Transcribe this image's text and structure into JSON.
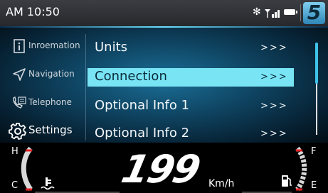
{
  "status": {
    "time": "AM 10:50",
    "bluetooth_glyph": "✻"
  },
  "sidebar": {
    "items": [
      {
        "label": "Inroemation",
        "icon": "info-icon"
      },
      {
        "label": "Navigation",
        "icon": "navigation-arrow-icon"
      },
      {
        "label": "Telephone",
        "icon": "telephone-icon"
      },
      {
        "label": "Settings",
        "icon": "gear-icon",
        "active": true
      }
    ]
  },
  "menu": {
    "items": [
      {
        "label": "Units",
        "arrow": ">>>"
      },
      {
        "label": "Connection",
        "arrow": ">>>",
        "selected": true
      },
      {
        "label": "Optional Info 1",
        "arrow": ">>>"
      },
      {
        "label": "Optional Info 2",
        "arrow": ">>>"
      }
    ]
  },
  "cluster": {
    "speed": "199",
    "unit": "Km/h",
    "temp_high": "H",
    "temp_low": "C",
    "fuel_full": "F",
    "fuel_empty": "E"
  },
  "brand_letter": "5",
  "colors": {
    "accent": "#79e5f4",
    "warning": "#e02020"
  }
}
